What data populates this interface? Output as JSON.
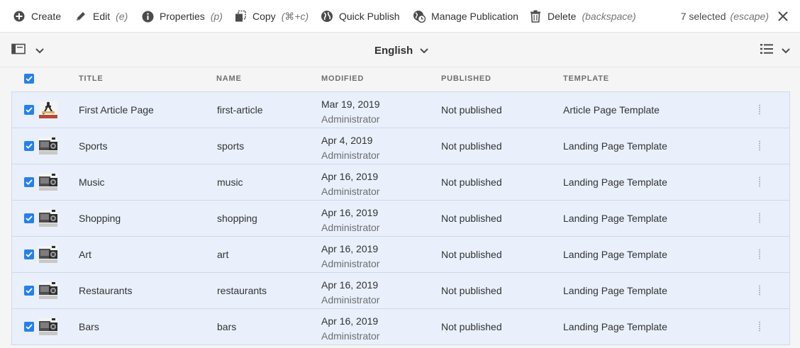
{
  "actionbar": {
    "create": {
      "label": "Create",
      "icon": "add-circle-icon"
    },
    "edit": {
      "label": "Edit",
      "hint": "(e)",
      "icon": "pencil-icon"
    },
    "properties": {
      "label": "Properties",
      "hint": "(p)",
      "icon": "info-icon"
    },
    "copy": {
      "label": "Copy",
      "hint": "(⌘+c)",
      "icon": "copy-icon"
    },
    "quick_publish": {
      "label": "Quick Publish",
      "icon": "globe-icon"
    },
    "manage_publication": {
      "label": "Manage Publication",
      "icon": "globe-clock-icon"
    },
    "delete": {
      "label": "Delete",
      "hint": "(backspace)",
      "icon": "trash-icon"
    },
    "selected": {
      "label": "7 selected",
      "hint": "(escape)",
      "icon": "close-icon"
    }
  },
  "subbar": {
    "rail_icon": "rail-toggle-icon",
    "language": "English",
    "view_icon": "list-view-icon"
  },
  "table": {
    "columns": [
      "TITLE",
      "NAME",
      "MODIFIED",
      "PUBLISHED",
      "TEMPLATE"
    ],
    "rows": [
      {
        "title": "First Article Page",
        "name": "first-article",
        "modified_date": "Mar 19, 2019",
        "modified_by": "Administrator",
        "published": "Not published",
        "template": "Article Page Template",
        "thumb": "article-thumbnail"
      },
      {
        "title": "Sports",
        "name": "sports",
        "modified_date": "Apr 4, 2019",
        "modified_by": "Administrator",
        "published": "Not published",
        "template": "Landing Page Template",
        "thumb": "landing-thumbnail"
      },
      {
        "title": "Music",
        "name": "music",
        "modified_date": "Apr 16, 2019",
        "modified_by": "Administrator",
        "published": "Not published",
        "template": "Landing Page Template",
        "thumb": "landing-thumbnail"
      },
      {
        "title": "Shopping",
        "name": "shopping",
        "modified_date": "Apr 16, 2019",
        "modified_by": "Administrator",
        "published": "Not published",
        "template": "Landing Page Template",
        "thumb": "landing-thumbnail"
      },
      {
        "title": "Art",
        "name": "art",
        "modified_date": "Apr 16, 2019",
        "modified_by": "Administrator",
        "published": "Not published",
        "template": "Landing Page Template",
        "thumb": "landing-thumbnail"
      },
      {
        "title": "Restaurants",
        "name": "restaurants",
        "modified_date": "Apr 16, 2019",
        "modified_by": "Administrator",
        "published": "Not published",
        "template": "Landing Page Template",
        "thumb": "landing-thumbnail"
      },
      {
        "title": "Bars",
        "name": "bars",
        "modified_date": "Apr 16, 2019",
        "modified_by": "Administrator",
        "published": "Not published",
        "template": "Landing Page Template",
        "thumb": "landing-thumbnail"
      }
    ]
  },
  "colors": {
    "accent": "#2680eb",
    "selected_row": "#e9f0fb"
  }
}
